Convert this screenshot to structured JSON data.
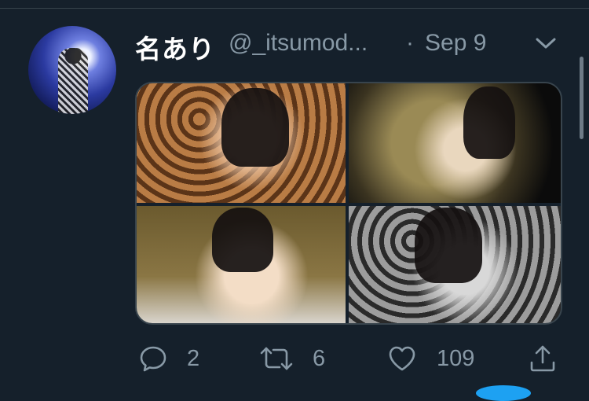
{
  "tweet": {
    "display_name": "名あり",
    "handle": "@_itsumod...",
    "separator": "·",
    "date": "Sep 9",
    "media": {
      "photo_count": 4
    }
  },
  "actions": {
    "replies": "2",
    "retweets": "6",
    "likes": "109"
  },
  "icons": {
    "reply": "reply-icon",
    "retweet": "retweet-icon",
    "like": "heart-icon",
    "share": "share-icon",
    "menu": "chevron-down-icon"
  },
  "colors": {
    "background": "#15202b",
    "text_primary": "#ffffff",
    "text_secondary": "#8899a6",
    "border": "#38444d",
    "accent": "#1da1f2"
  }
}
